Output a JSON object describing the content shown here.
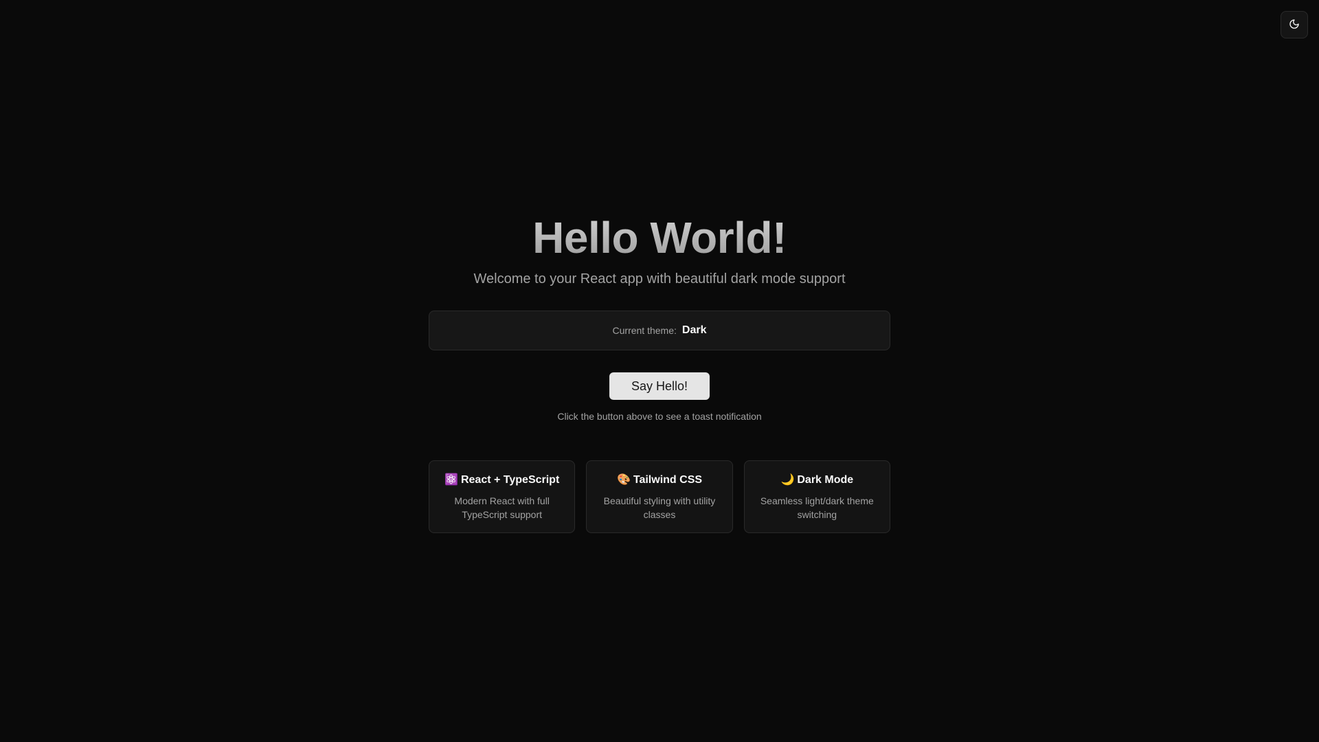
{
  "theme_toggle": {
    "icon": "moon-icon"
  },
  "hero": {
    "title": "Hello World!",
    "subtitle": "Welcome to your React app with beautiful dark mode support"
  },
  "theme_box": {
    "label": "Current theme:",
    "value": "Dark"
  },
  "say_hello": {
    "label": "Say Hello!",
    "hint": "Click the button above to see a toast notification"
  },
  "features": [
    {
      "emoji": "⚛️",
      "title": "React + TypeScript",
      "desc": "Modern React with full TypeScript support",
      "icon": "atom-icon"
    },
    {
      "emoji": "🎨",
      "title": "Tailwind CSS",
      "desc": "Beautiful styling with utility classes",
      "icon": "palette-icon"
    },
    {
      "emoji": "🌙",
      "title": "Dark Mode",
      "desc": "Seamless light/dark theme switching",
      "icon": "crescent-moon-icon"
    }
  ],
  "colors": {
    "background": "#0a0a0a",
    "card": "#141414",
    "border": "#2a2a2a",
    "muted_text": "#a3a3a3",
    "button_bg": "#e5e5e5"
  }
}
